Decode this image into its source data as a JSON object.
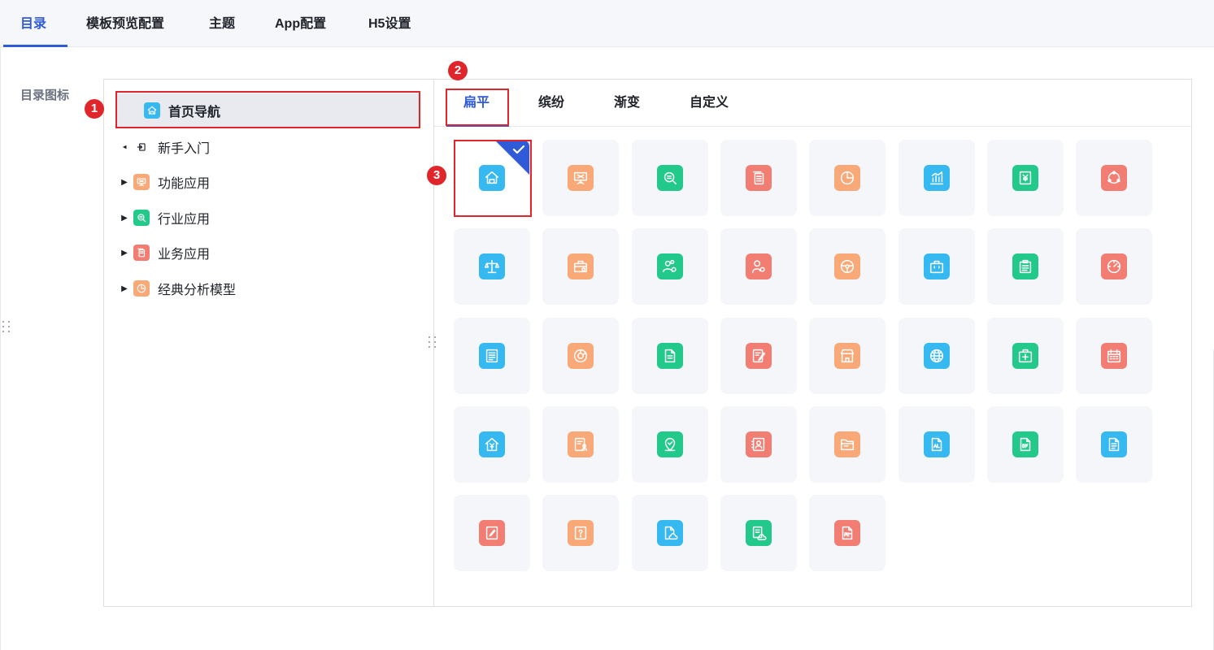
{
  "top_tabs": [
    {
      "label": "目录",
      "active": true
    },
    {
      "label": "模板预览配置"
    },
    {
      "label": "主题"
    },
    {
      "label": "App配置"
    },
    {
      "label": "H5设置"
    }
  ],
  "section_label": "目录图标",
  "tree": [
    {
      "label": "首页导航",
      "selected": true,
      "icon": "home-icon",
      "icon_color": "#36b8f0",
      "arrow": ""
    },
    {
      "label": "新手入门",
      "icon": "enter-icon",
      "icon_color": "",
      "arrow": "▲"
    },
    {
      "label": "功能应用",
      "icon": "presentation-icon",
      "icon_color": "#f9a878",
      "arrow": "▶"
    },
    {
      "label": "行业应用",
      "icon": "search-list-icon",
      "icon_color": "#23c98a",
      "arrow": "▶"
    },
    {
      "label": "业务应用",
      "icon": "document-icon",
      "icon_color": "#f27d73",
      "arrow": "▶"
    },
    {
      "label": "经典分析模型",
      "icon": "pie-icon",
      "icon_color": "#f9a878",
      "arrow": "▶"
    }
  ],
  "style_tabs": [
    {
      "label": "扁平",
      "active": true
    },
    {
      "label": "缤纷"
    },
    {
      "label": "渐变"
    },
    {
      "label": "自定义"
    }
  ],
  "icons": [
    {
      "name": "home-icon",
      "color": "#36b8f0",
      "selected": true
    },
    {
      "name": "presentation-icon",
      "color": "#f9a878"
    },
    {
      "name": "search-list-icon",
      "color": "#23c98a"
    },
    {
      "name": "document-stack-icon",
      "color": "#f27d73"
    },
    {
      "name": "pie-chart-icon",
      "color": "#f9a878"
    },
    {
      "name": "bar-chart-icon",
      "color": "#36b8f0"
    },
    {
      "name": "yuan-doc-icon",
      "color": "#23c98a"
    },
    {
      "name": "cycle-icon",
      "color": "#f27d73"
    },
    {
      "name": "balance-scale-icon",
      "color": "#36b8f0"
    },
    {
      "name": "briefcase-gear-icon",
      "color": "#f9a878"
    },
    {
      "name": "team-gear-icon",
      "color": "#23c98a"
    },
    {
      "name": "user-gear-icon",
      "color": "#f27d73"
    },
    {
      "name": "steering-wheel-icon",
      "color": "#f9a878"
    },
    {
      "name": "shopping-bag-icon",
      "color": "#36b8f0"
    },
    {
      "name": "clipboard-icon",
      "color": "#23c98a"
    },
    {
      "name": "speedometer-icon",
      "color": "#f27d73"
    },
    {
      "name": "text-document-icon",
      "color": "#36b8f0"
    },
    {
      "name": "donut-icon",
      "color": "#f9a878"
    },
    {
      "name": "file-icon",
      "color": "#23c98a"
    },
    {
      "name": "notebook-edit-icon",
      "color": "#f27d73"
    },
    {
      "name": "store-icon",
      "color": "#f9a878"
    },
    {
      "name": "globe-icon",
      "color": "#36b8f0"
    },
    {
      "name": "medical-kit-icon",
      "color": "#23c98a"
    },
    {
      "name": "calendar-icon",
      "color": "#f27d73"
    },
    {
      "name": "house-yuan-icon",
      "color": "#36b8f0"
    },
    {
      "name": "report-person-icon",
      "color": "#f9a878"
    },
    {
      "name": "location-check-icon",
      "color": "#23c98a"
    },
    {
      "name": "contact-card-icon",
      "color": "#f27d73"
    },
    {
      "name": "folder-icon",
      "color": "#f9a878"
    },
    {
      "name": "file-type-a-icon",
      "color": "#36b8f0"
    },
    {
      "name": "file-type-b-icon",
      "color": "#23c98a"
    },
    {
      "name": "file-lines-icon",
      "color": "#36b8f0"
    },
    {
      "name": "edit-document-icon",
      "color": "#f27d73"
    },
    {
      "name": "question-document-icon",
      "color": "#f9a878"
    },
    {
      "name": "cloud-document-icon",
      "color": "#36b8f0"
    },
    {
      "name": "cloud-report-icon",
      "color": "#23c98a"
    },
    {
      "name": "file-type-c-icon",
      "color": "#f27d73"
    }
  ],
  "annotations": [
    "1",
    "2",
    "3"
  ],
  "colors": {
    "accent": "#2f5bd9",
    "annotation": "#e0262a",
    "blue": "#36b8f0",
    "orange": "#f9a878",
    "green": "#23c98a",
    "red": "#f27d73"
  }
}
